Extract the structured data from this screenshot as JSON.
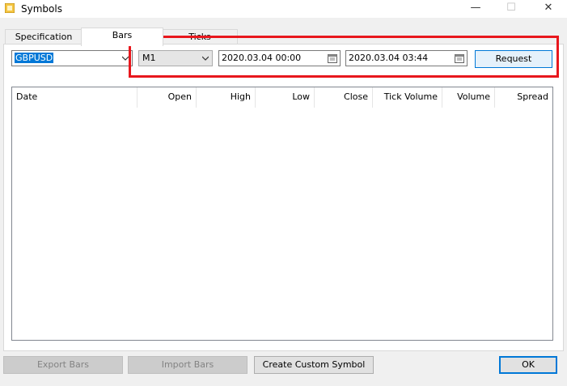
{
  "window": {
    "title": "Symbols",
    "minimize": "—",
    "maximize": "☐",
    "close": "✕"
  },
  "tabs": [
    "Specification",
    "Bars",
    "Ticks"
  ],
  "toolbar": {
    "symbol": "GBPUSD",
    "timeframe": "M1",
    "date_from": "2020.03.04 00:00",
    "date_to": "2020.03.04 03:44",
    "request_label": "Request"
  },
  "columns": [
    "Date",
    "Open",
    "High",
    "Low",
    "Close",
    "Tick Volume",
    "Volume",
    "Spread"
  ],
  "footer": {
    "export_label": "Export Bars",
    "import_label": "Import Bars",
    "custom_label": "Create Custom Symbol",
    "ok_label": "OK"
  },
  "colors": {
    "highlight": "#e8171d",
    "accent": "#0078d7"
  }
}
